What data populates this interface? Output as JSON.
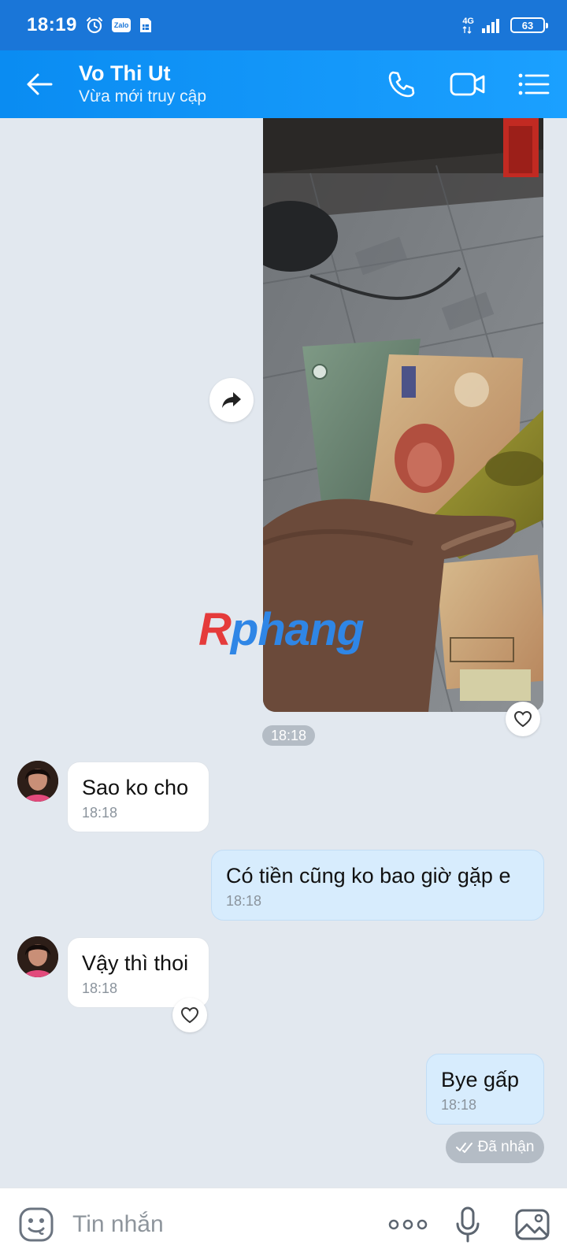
{
  "status_bar": {
    "time": "18:19",
    "zalo_badge": "Zalo",
    "network": "4G",
    "battery": "63"
  },
  "header": {
    "contact_name": "Vo Thi Ut",
    "contact_status": "Vừa mới truy cập"
  },
  "watermark": {
    "first": "R",
    "rest": "phang"
  },
  "image_message": {
    "time": "18:18"
  },
  "messages": [
    {
      "text": "Sao ko cho",
      "time": "18:18"
    },
    {
      "text": "Có tiền cũng ko bao giờ gặp e",
      "time": "18:18"
    },
    {
      "text": "Vậy thì thoi",
      "time": "18:18"
    },
    {
      "text": "Bye gấp",
      "time": "18:18"
    }
  ],
  "delivery_status": "Đã nhận",
  "input": {
    "placeholder": "Tin nhắn"
  },
  "colors": {
    "header": "#1ba0ff",
    "status_bar": "#1a76d8",
    "chat_background": "#e2e8ef",
    "outgoing_bubble": "#d7ecfd",
    "incoming_bubble": "#ffffff"
  },
  "icons": {
    "back": "arrow-left-icon",
    "call": "phone-icon",
    "video": "video-camera-icon",
    "menu": "list-menu-icon",
    "forward": "forward-arrow-icon",
    "like": "heart-icon",
    "emoji": "emoji-face-icon",
    "more": "more-dots-icon",
    "voice": "microphone-icon",
    "gallery": "image-gallery-icon"
  }
}
